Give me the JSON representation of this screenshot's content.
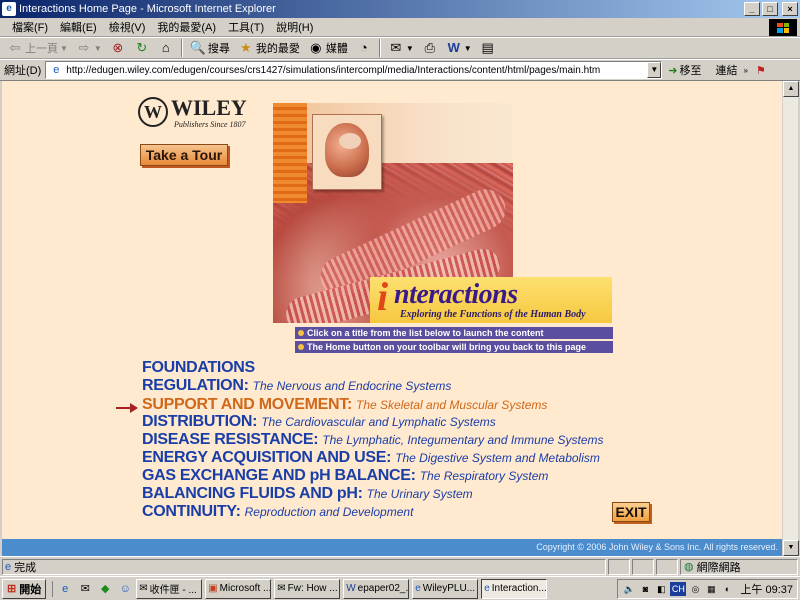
{
  "window": {
    "title": "Interactions Home Page - Microsoft Internet Explorer",
    "min_glyph": "_",
    "max_glyph": "□",
    "close_glyph": "×"
  },
  "menu": [
    "檔案(F)",
    "編輯(E)",
    "檢視(V)",
    "我的最愛(A)",
    "工具(T)",
    "說明(H)"
  ],
  "toolbar": {
    "back_label": "上一頁",
    "search_label": "搜尋",
    "favorites_label": "我的最愛",
    "media_label": "媒體"
  },
  "address": {
    "label": "網址(D)",
    "url": "http://edugen.wiley.com/edugen/courses/crs1427/simulations/intercompl/media/Interactions/content/html/pages/main.htm",
    "go_label": "移至",
    "links_label": "連結"
  },
  "page": {
    "logo_word": "WILEY",
    "logo_since": "Publishers Since 1807",
    "tour_label": "Take a Tour",
    "title_i": "i",
    "title_rest": "nteractions",
    "subtitle": "Exploring the Functions of the Human Body",
    "instructions": [
      "Click on a title from the list below to launch the content",
      "The Home button on your toolbar will bring you back to this page"
    ],
    "topics": [
      {
        "title": "FOUNDATIONS",
        "desc": ""
      },
      {
        "title": "REGULATION:",
        "desc": "The Nervous and Endocrine Systems"
      },
      {
        "title": "SUPPORT AND MOVEMENT:",
        "desc": "The Skeletal and Muscular Systems"
      },
      {
        "title": "DISTRIBUTION:",
        "desc": "The Cardiovascular and Lymphatic Systems"
      },
      {
        "title": "DISEASE RESISTANCE:",
        "desc": "The Lymphatic, Integumentary and Immune Systems"
      },
      {
        "title": "ENERGY ACQUISITION AND USE:",
        "desc": "The Digestive System and Metabolism"
      },
      {
        "title": "GAS EXCHANGE AND pH BALANCE:",
        "desc": "The Respiratory System"
      },
      {
        "title": "BALANCING FLUIDS AND pH:",
        "desc": "The Urinary System"
      },
      {
        "title": "CONTINUITY:",
        "desc": "Reproduction and Development"
      }
    ],
    "exit_label": "EXIT",
    "copyright": "Copyright © 2006 John Wiley & Sons Inc. All rights reserved."
  },
  "status": {
    "text": "完成",
    "zone": "網際網路"
  },
  "taskbar": {
    "start_label": "開始",
    "tasks": [
      "收件匣 - ...",
      "Microsoft ...",
      "Fw: How ...",
      "epaper02_...",
      "WileyPLU...",
      "Interaction..."
    ],
    "ime": "CH",
    "clock": "上午 09:37"
  },
  "colors": {
    "page_bg": "#ffe9cf",
    "topic_blue": "#1a3ea8",
    "topic_active": "#d0681a",
    "footer_band": "#4a8ccc"
  }
}
